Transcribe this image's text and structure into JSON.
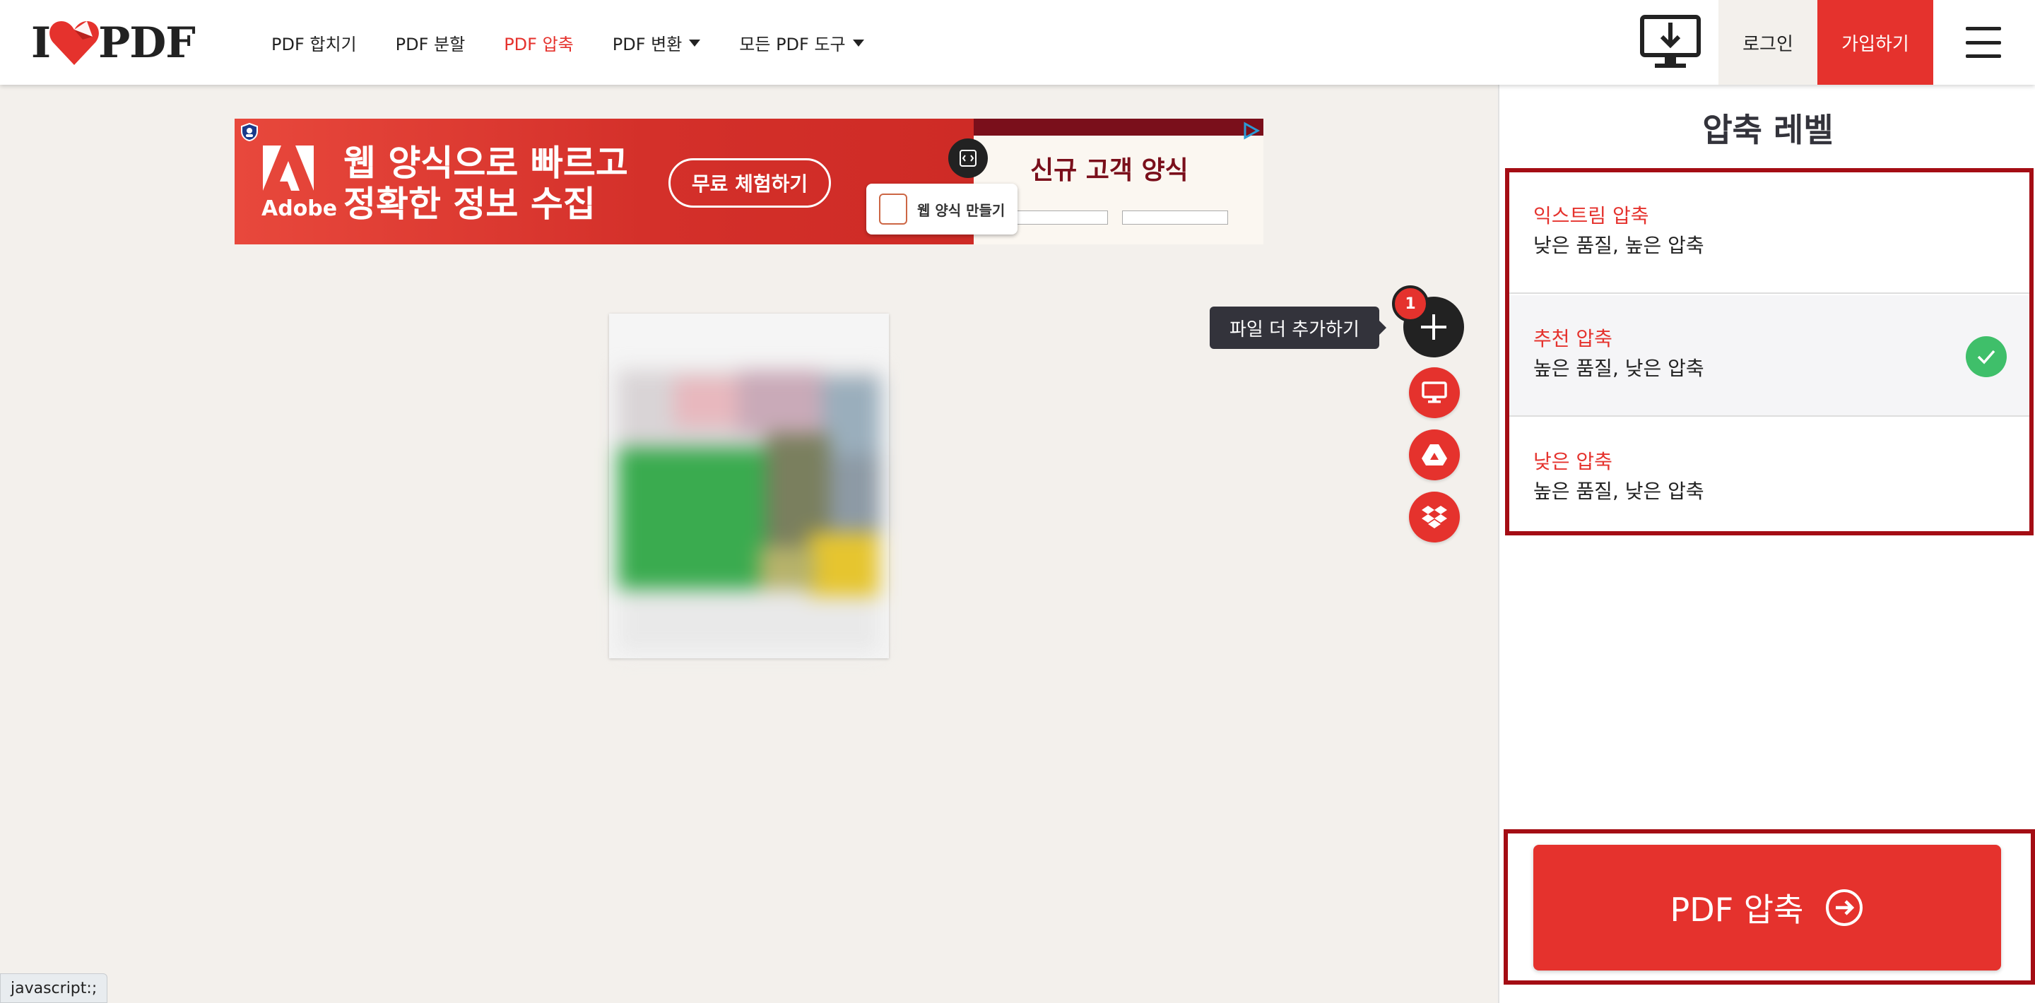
{
  "header": {
    "logo_left": "I",
    "logo_right": "PDF",
    "nav": [
      {
        "label": "PDF 합치기",
        "active": false,
        "dropdown": false
      },
      {
        "label": "PDF 분할",
        "active": false,
        "dropdown": false
      },
      {
        "label": "PDF 압축",
        "active": true,
        "dropdown": false
      },
      {
        "label": "PDF 변환",
        "active": false,
        "dropdown": true
      },
      {
        "label": "모든 PDF 도구",
        "active": false,
        "dropdown": true
      }
    ],
    "login_label": "로그인",
    "signup_label": "가입하기",
    "desktop_icon": "desktop-download-icon",
    "menu_icon": "hamburger-menu-icon"
  },
  "ad": {
    "brand": "Adobe",
    "headline_line1": "웹 양식으로 빠르고",
    "headline_line2": "정확한 정보 수집",
    "cta": "무료 체험하기",
    "form_title": "신규 고객 양식",
    "make_form": "웹 양식 만들기"
  },
  "upload": {
    "tooltip": "파일 더 추가하기",
    "file_count": "1",
    "actions": [
      "add-files-icon",
      "computer-icon",
      "google-drive-icon",
      "dropbox-icon"
    ]
  },
  "sidebar": {
    "title": "압축 레벨",
    "levels": [
      {
        "name": "익스트림 압축",
        "desc": "낮은 품질, 높은 압축",
        "selected": false
      },
      {
        "name": "추천 압축",
        "desc": "높은 품질, 낮은 압축",
        "selected": true
      },
      {
        "name": "낮은 압축",
        "desc": "높은 품질, 낮은 압축",
        "selected": false
      }
    ],
    "compress_label": "PDF 압축"
  },
  "status_bar": "javascript:;",
  "colors": {
    "brand_red": "#e5322d",
    "highlight_border": "#a40d14",
    "check_green": "#3fbf6a",
    "page_bg": "#f3f0ec"
  }
}
